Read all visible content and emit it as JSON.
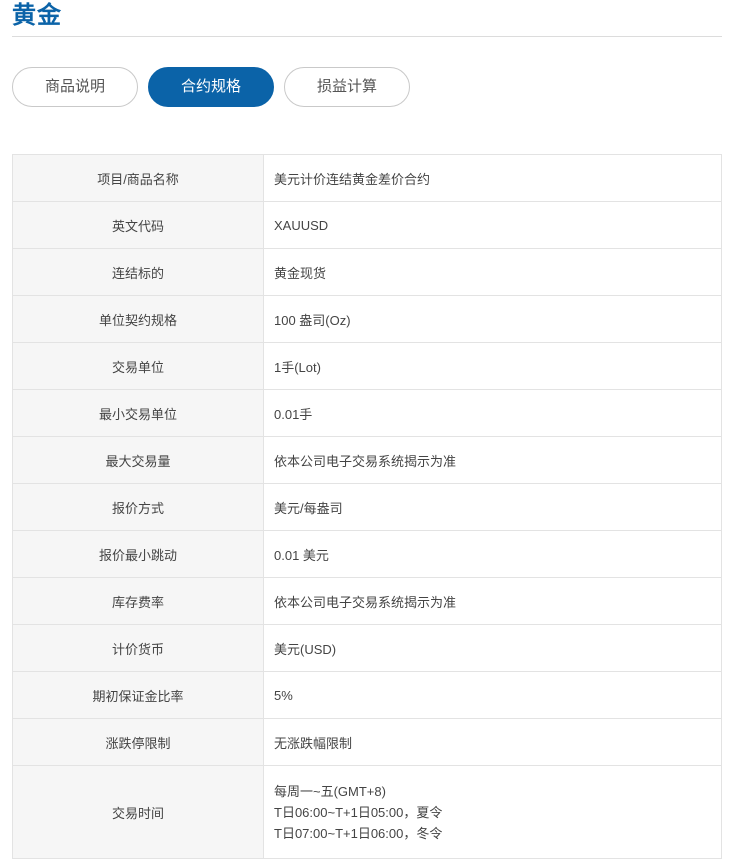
{
  "page": {
    "title": "黄金"
  },
  "tabs": [
    {
      "label": "商品说明",
      "active": false
    },
    {
      "label": "合约规格",
      "active": true
    },
    {
      "label": "损益计算",
      "active": false
    }
  ],
  "spec": {
    "rows": [
      {
        "key": "项目/商品名称",
        "value": "美元计价连结黄金差价合约"
      },
      {
        "key": "英文代码",
        "value": "XAUUSD"
      },
      {
        "key": "连结标的",
        "value": "黄金现货"
      },
      {
        "key": "单位契约规格",
        "value": "100 盎司(Oz)"
      },
      {
        "key": "交易单位",
        "value": "1手(Lot)"
      },
      {
        "key": "最小交易单位",
        "value": "0.01手"
      },
      {
        "key": "最大交易量",
        "value": "依本公司电子交易系统揭示为准"
      },
      {
        "key": "报价方式",
        "value": "美元/每盎司"
      },
      {
        "key": "报价最小跳动",
        "value": "0.01 美元"
      },
      {
        "key": "库存费率",
        "value": "依本公司电子交易系统揭示为准"
      },
      {
        "key": "计价货币",
        "value": "美元(USD)"
      },
      {
        "key": "期初保证金比率",
        "value": "5%"
      },
      {
        "key": "涨跌停限制",
        "value": "无涨跌幅限制"
      }
    ],
    "trading_time": {
      "key": "交易时间",
      "lines": [
        "每周一~五(GMT+8)",
        "T日06:00~T+1日05:00，夏令",
        "T日07:00~T+1日06:00，冬令"
      ]
    }
  },
  "colors": {
    "brand": "#0b63a8",
    "row_key_bg": "#f6f6f6",
    "border": "#e3e3e3"
  }
}
